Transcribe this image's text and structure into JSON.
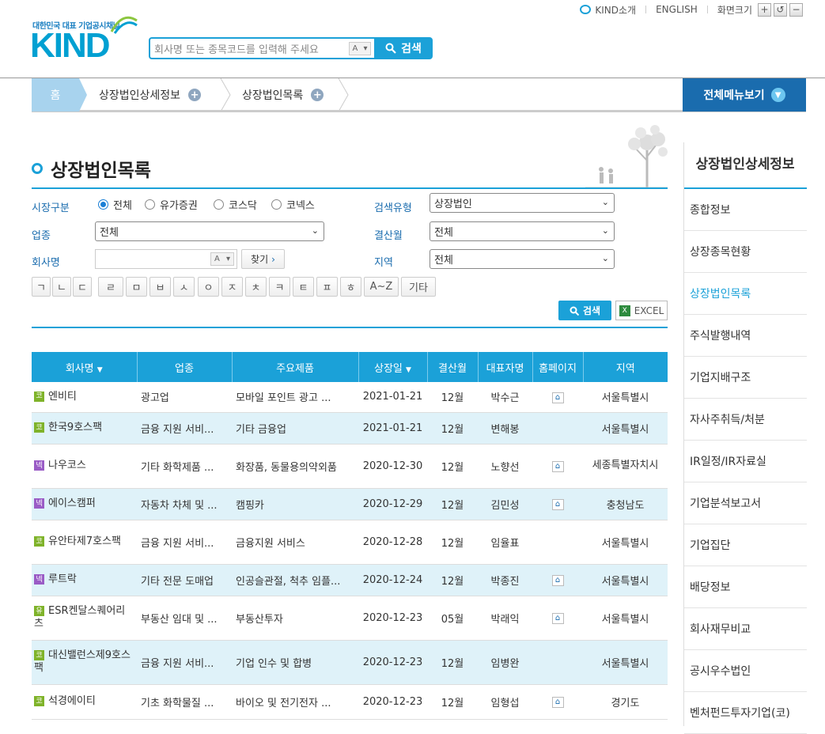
{
  "util": {
    "kind_intro": "KIND소개",
    "english": "ENGLISH",
    "zoom_label": "화면크기"
  },
  "logo": {
    "subtitle": "대한민국 대표 기업공시채널",
    "name": "KIND"
  },
  "search": {
    "placeholder": "회사명 또는 종목코드를 입력해 주세요",
    "ime": "A",
    "button": "검색"
  },
  "nav": {
    "home": "홈",
    "crumb1": "상장법인상세정보",
    "crumb2": "상장법인목록",
    "all_menu": "전체메뉴보기"
  },
  "page": {
    "title": "상장법인목록"
  },
  "form": {
    "market_label": "시장구분",
    "markets": [
      "전체",
      "유가증권",
      "코스닥",
      "코넥스"
    ],
    "search_type_label": "검색유형",
    "search_type": "상장법인",
    "industry_label": "업종",
    "industry": "전체",
    "settle_label": "결산월",
    "settle": "전체",
    "company_label": "회사명",
    "company_ime": "A",
    "find": "찾기",
    "region_label": "지역",
    "region": "전체",
    "jamo": [
      "ㄱ",
      "ㄴ",
      "ㄷ",
      "ㄹ",
      "ㅁ",
      "ㅂ",
      "ㅅ",
      "ㅇ",
      "ㅈ",
      "ㅊ",
      "ㅋ",
      "ㅌ",
      "ㅍ",
      "ㅎ",
      "A~Z",
      "기타"
    ],
    "search_btn": "검색",
    "excel_btn": "EXCEL"
  },
  "table": {
    "headers": [
      "회사명",
      "업종",
      "주요제품",
      "상장일",
      "결산월",
      "대표자명",
      "홈페이지",
      "지역"
    ],
    "rows": [
      {
        "mark": "코",
        "name": "엔비티",
        "industry": "광고업",
        "product": "모바일 포인트 광고 ...",
        "date": "2021-01-21",
        "settle": "12월",
        "ceo": "박수근",
        "home": true,
        "region": "서울특별시"
      },
      {
        "mark": "코",
        "name": "한국9호스팩",
        "industry": "금융 지원 서비...",
        "product": "기타 금융업",
        "date": "2021-01-21",
        "settle": "12월",
        "ceo": "변해봉",
        "home": false,
        "region": "서울특별시"
      },
      {
        "mark": "넥",
        "name": "나우코스",
        "industry": "기타 화학제품 ...",
        "product": "화장품, 동물용의약외품",
        "date": "2020-12-30",
        "settle": "12월",
        "ceo": "노향선",
        "home": true,
        "region": "세종특별자치시"
      },
      {
        "mark": "넥",
        "name": "에이스캠퍼",
        "industry": "자동차 차체 및 ...",
        "product": "캠핑카",
        "date": "2020-12-29",
        "settle": "12월",
        "ceo": "김민성",
        "home": true,
        "region": "충청남도"
      },
      {
        "mark": "코",
        "name": "유안타제7호스팩",
        "industry": "금융 지원 서비...",
        "product": "금융지원 서비스",
        "date": "2020-12-28",
        "settle": "12월",
        "ceo": "임율표",
        "home": false,
        "region": "서울특별시"
      },
      {
        "mark": "넥",
        "name": "루트락",
        "industry": "기타 전문 도매업",
        "product": "인공슬관절, 척추 임플...",
        "date": "2020-12-24",
        "settle": "12월",
        "ceo": "박종진",
        "home": true,
        "region": "서울특별시"
      },
      {
        "mark": "유",
        "name": "ESR켄달스퀘어리츠",
        "industry": "부동산 임대 및 ...",
        "product": "부동산투자",
        "date": "2020-12-23",
        "settle": "05월",
        "ceo": "박래익",
        "home": true,
        "region": "서울특별시"
      },
      {
        "mark": "코",
        "name": "대신밸런스제9호스팩",
        "industry": "금융 지원 서비...",
        "product": "기업 인수 및 합병",
        "date": "2020-12-23",
        "settle": "12월",
        "ceo": "임병완",
        "home": false,
        "region": "서울특별시"
      },
      {
        "mark": "코",
        "name": "석경에이티",
        "industry": "기초 화학물질 ...",
        "product": "바이오 및 전기전자 ...",
        "date": "2020-12-23",
        "settle": "12월",
        "ceo": "임형섭",
        "home": true,
        "region": "경기도"
      }
    ]
  },
  "side": {
    "title": "상장법인상세정보",
    "items": [
      "종합정보",
      "상장종목현황",
      "상장법인목록",
      "주식발행내역",
      "기업지배구조",
      "자사주취득/처분",
      "IR일정/IR자료실",
      "기업분석보고서",
      "기업집단",
      "배당정보",
      "회사재무비교",
      "공시우수법인",
      "벤처펀드투자기업(코)"
    ]
  }
}
